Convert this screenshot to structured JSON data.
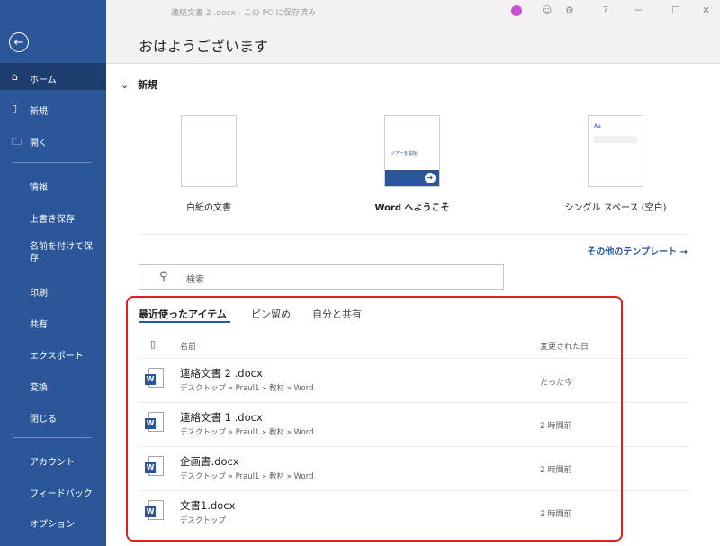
{
  "window": {
    "title": "連絡文書 2 .docx - この PC に保存済み"
  },
  "header": {
    "greeting": "おはようございます"
  },
  "sidebar": {
    "back_icon": "back-arrow-icon",
    "items": [
      {
        "label": "ホーム",
        "icon": "home-icon"
      },
      {
        "label": "新規",
        "icon": "new-doc-icon"
      },
      {
        "label": "開く",
        "icon": "folder-icon"
      },
      {
        "label": "情報"
      },
      {
        "label": "上書き保存"
      },
      {
        "label": "名前を付けて保存"
      },
      {
        "label": "印刷"
      },
      {
        "label": "共有"
      },
      {
        "label": "エクスポート"
      },
      {
        "label": "変換"
      },
      {
        "label": "閉じる"
      },
      {
        "label": "アカウント"
      },
      {
        "label": "フィードバック"
      },
      {
        "label": "オプション"
      }
    ]
  },
  "new_section": {
    "title": "新規",
    "templates": [
      {
        "label": "白紙の文書"
      },
      {
        "label": "Word へようこそ",
        "thumb_text": "ツアーを開始"
      },
      {
        "label": "シングル スペース (空白)",
        "thumb_text": "Aa"
      }
    ],
    "more": "その他のテンプレート →"
  },
  "search": {
    "placeholder": "検索"
  },
  "tabs": [
    {
      "label": "最近使ったアイテム"
    },
    {
      "label": "ピン留め"
    },
    {
      "label": "自分と共有"
    }
  ],
  "table": {
    "col_name": "名前",
    "col_date": "変更された日",
    "rows": [
      {
        "name": "連絡文書 2 .docx",
        "path": "デスクトップ » Praul1 » 教材 » Word",
        "date": "たった今"
      },
      {
        "name": "連絡文書 1 .docx",
        "path": "デスクトップ » Praul1 » 教材 » Word",
        "date": "2 時間前"
      },
      {
        "name": "企画書.docx",
        "path": "デスクトップ » Praul1 » 教材 » Word",
        "date": "2 時間前"
      },
      {
        "name": "文書1.docx",
        "path": "デスクトップ",
        "date": "2 時間前"
      }
    ]
  },
  "colors": {
    "accent": "#2b579a",
    "highlight": "#e02020"
  }
}
